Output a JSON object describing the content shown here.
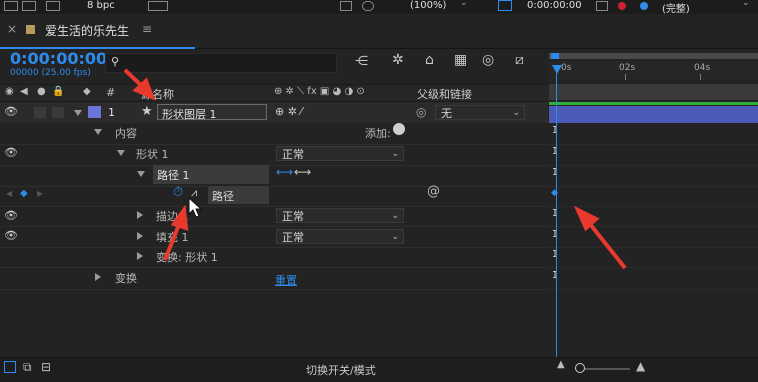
{
  "topbar": {
    "bpc": "8 bpc",
    "zoom": "(100%)",
    "timecode": "0:00:00:00",
    "view": "(完整)"
  },
  "tab": {
    "title": "爱生活的乐先生",
    "menu": "≡"
  },
  "timecode": {
    "main": "0:00:00:00",
    "sub": "00000 (25.00 fps)"
  },
  "search": {
    "placeholder": ""
  },
  "columns": {
    "hash": "#",
    "source": "源名称",
    "parent": "父级和链接"
  },
  "layer": {
    "number": "1",
    "name": "形状图层 1",
    "parent_value": "无"
  },
  "tree": {
    "contents": "内容",
    "add": "添加:",
    "shape": "形状 1",
    "shape_blend": "正常",
    "path": "路径 1",
    "path_prop": "路径",
    "stroke": "描边 1",
    "stroke_blend": "正常",
    "fill": "填充 1",
    "fill_blend": "正常",
    "transform_shape": "变换: 形状 1",
    "transform": "变换",
    "reset": "重置"
  },
  "ruler": {
    "t0": "0s",
    "t2": "02s",
    "t4": "04s"
  },
  "status": {
    "toggle": "切换开关/模式"
  },
  "colors": {
    "accent": "#2d8ceb",
    "layer_label": "#6b74d9",
    "layer_bar": "#4e5ab8",
    "arrow": "#e8392c"
  }
}
